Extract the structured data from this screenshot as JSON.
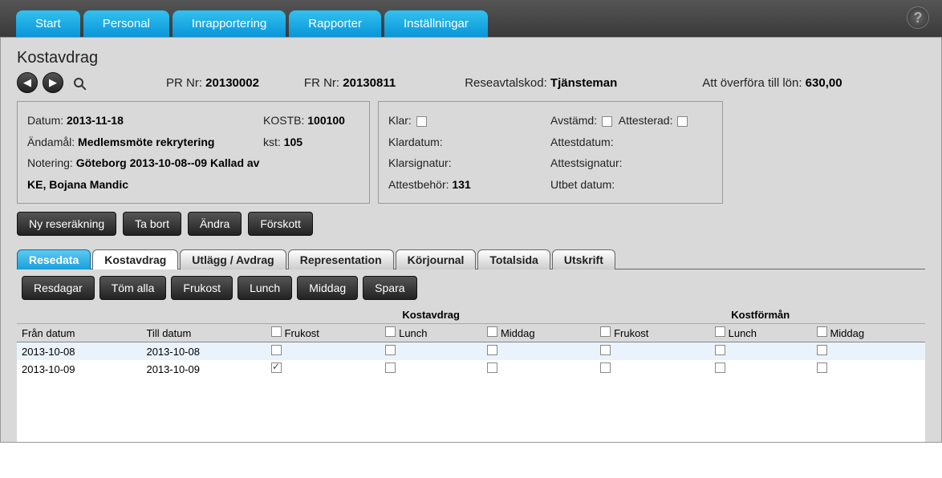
{
  "top_tabs": [
    "Start",
    "Personal",
    "Inrapportering",
    "Rapporter",
    "Inställningar"
  ],
  "page_title": "Kostavdrag",
  "header": {
    "pr_label": "PR Nr:",
    "pr_value": "20130002",
    "fr_label": "FR Nr:",
    "fr_value": "20130811",
    "avtal_label": "Reseavtalskod:",
    "avtal_value": "Tjänsteman",
    "lon_label": "Att överföra till lön:",
    "lon_value": "630,00"
  },
  "panel_left": {
    "datum_label": "Datum:",
    "datum_value": "2013-11-18",
    "andamal_label": "Ändamål:",
    "andamal_value": "Medlemsmöte rekrytering",
    "notering_label": "Notering:",
    "notering_value": "Göteborg 2013-10-08--09 Kallad av KE, Bojana Mandic",
    "kostb_label": "KOSTB:",
    "kostb_value": "100100",
    "kst_label": "kst:",
    "kst_value": "105"
  },
  "panel_right": {
    "klar": "Klar:",
    "avstamd": "Avstämd:",
    "attesterad": "Attesterad:",
    "klardatum": "Klardatum:",
    "attestdatum": "Attestdatum:",
    "klarsignatur": "Klarsignatur:",
    "attestsignatur": "Attestsignatur:",
    "attestbehor_label": "Attestbehör:",
    "attestbehor_value": "131",
    "utbet_datum": "Utbet datum:"
  },
  "action_buttons_top": [
    "Ny reseräkning",
    "Ta bort",
    "Ändra",
    "Förskott"
  ],
  "sub_tabs": [
    "Resedata",
    "Kostavdrag",
    "Utlägg / Avdrag",
    "Representation",
    "Körjournal",
    "Totalsida",
    "Utskrift"
  ],
  "sub_tab_active_index": 0,
  "sub_tab_current_index": 1,
  "action_buttons_mid": [
    "Resdagar",
    "Töm alla",
    "Frukost",
    "Lunch",
    "Middag",
    "Spara"
  ],
  "grid": {
    "group_headers": [
      "",
      "Kostavdrag",
      "Kostförmån"
    ],
    "columns": [
      "Från datum",
      "Till datum",
      "Frukost",
      "Lunch",
      "Middag",
      "Frukost",
      "Lunch",
      "Middag"
    ],
    "rows": [
      {
        "from": "2013-10-08",
        "to": "2013-10-08",
        "checks": [
          false,
          false,
          false,
          false,
          false,
          false
        ]
      },
      {
        "from": "2013-10-09",
        "to": "2013-10-09",
        "checks": [
          true,
          false,
          false,
          false,
          false,
          false
        ]
      }
    ]
  }
}
